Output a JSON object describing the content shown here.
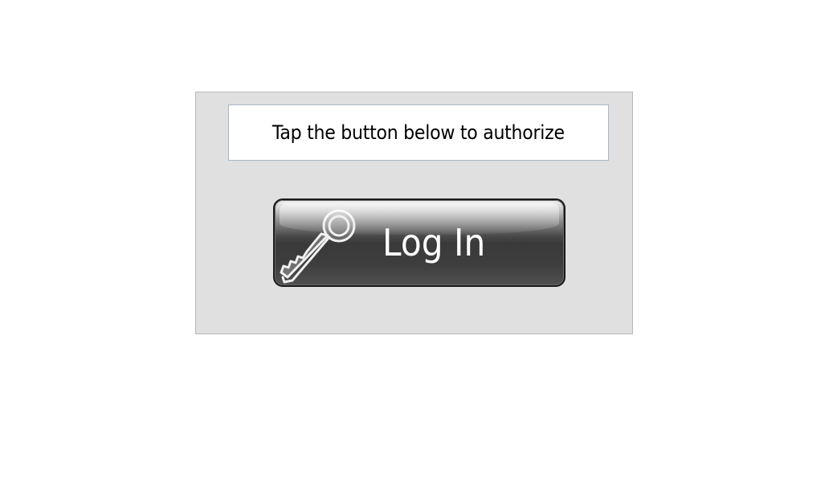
{
  "message": {
    "text": "Tap the button below to authorize"
  },
  "login_button": {
    "label": "Log In",
    "icon": "key-icon"
  },
  "colors": {
    "panel_background": "#e0e0e0",
    "button_dark": "#3a3a3a",
    "button_text": "#ffffff"
  }
}
